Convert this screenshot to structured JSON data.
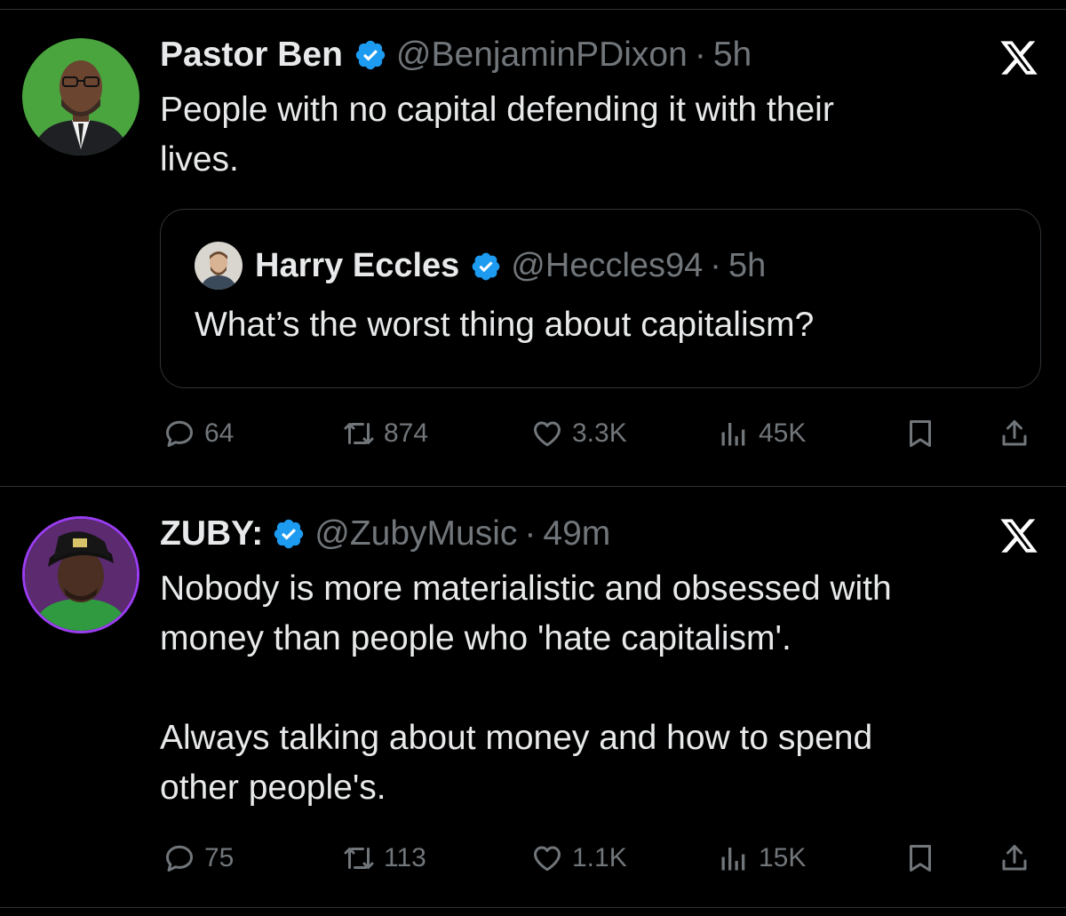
{
  "tweets": [
    {
      "author": {
        "name": "Pastor Ben",
        "handle": "@BenjaminPDixon",
        "separator": "·",
        "time": "5h"
      },
      "text": "People with no capital defending it with their\nlives.",
      "quote": {
        "author": {
          "name": "Harry Eccles",
          "handle": "@Heccles94",
          "separator": "·",
          "time": "5h"
        },
        "text": "What’s the worst thing about capitalism?"
      },
      "stats": {
        "replies": "64",
        "reposts": "874",
        "likes": "3.3K",
        "views": "45K"
      }
    },
    {
      "author": {
        "name": "ZUBY:",
        "handle": "@ZubyMusic",
        "separator": "·",
        "time": "49m"
      },
      "text": "Nobody is more materialistic and obsessed with\nmoney than people who 'hate capitalism'.\n\nAlways talking about money and how to spend\nother people's.",
      "stats": {
        "replies": "75",
        "reposts": "113",
        "likes": "1.1K",
        "views": "15K"
      }
    }
  ],
  "colors": {
    "background": "#000000",
    "primary_text": "#e7e9ea",
    "secondary_text": "#71767b",
    "verified": "#1d9bf0",
    "divider": "#2f3336"
  },
  "icons": [
    "x-logo-icon",
    "verified-badge-icon",
    "reply-icon",
    "repost-icon",
    "like-icon",
    "views-icon",
    "bookmark-icon",
    "share-icon"
  ]
}
